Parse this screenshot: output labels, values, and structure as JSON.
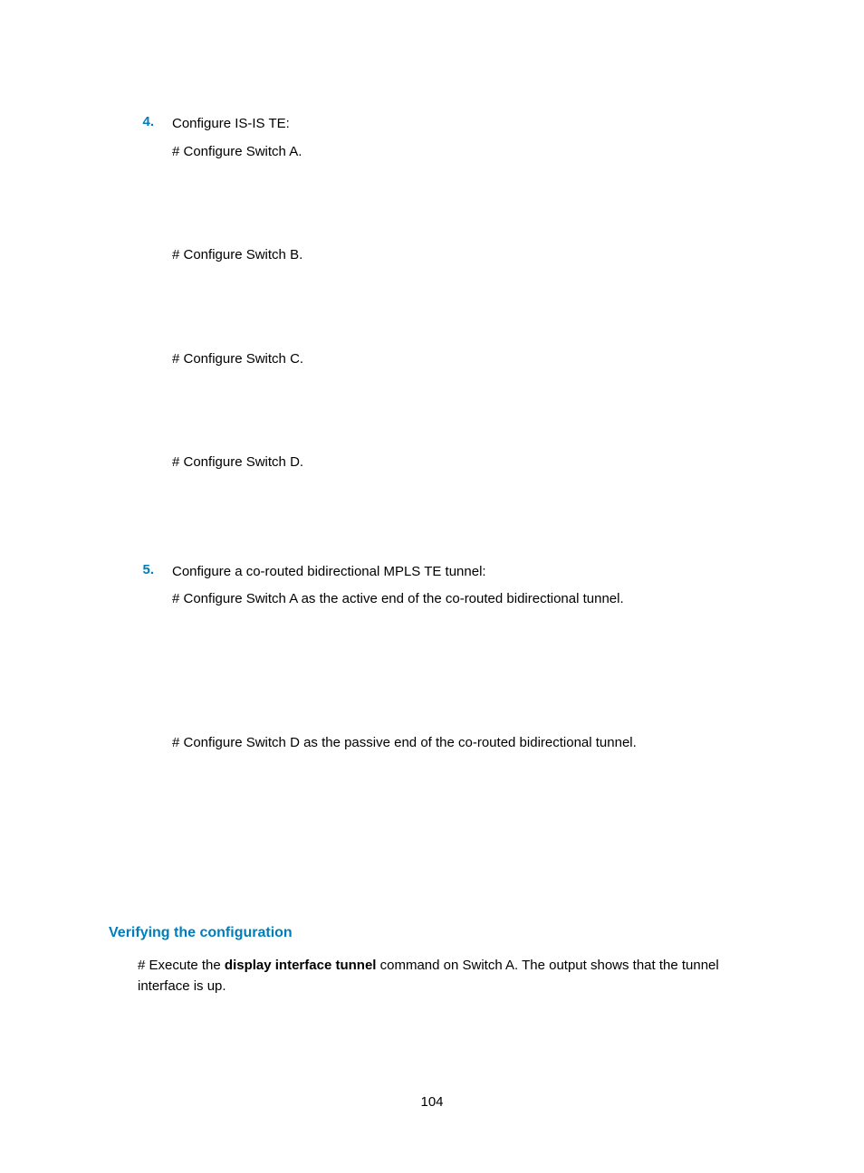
{
  "step4": {
    "num": "4.",
    "title": "Configure IS-IS TE:",
    "switchA": "# Configure Switch A.",
    "switchB": "# Configure Switch B.",
    "switchC": "# Configure Switch C.",
    "switchD": "# Configure Switch D."
  },
  "step5": {
    "num": "5.",
    "title": "Configure a co-routed bidirectional MPLS TE tunnel:",
    "switchA": "# Configure Switch A as the active end of the co-routed bidirectional tunnel.",
    "switchD": "# Configure Switch D as the passive end of the co-routed bidirectional tunnel."
  },
  "verify": {
    "heading": "Verifying the configuration",
    "text_pre": "# Execute the ",
    "text_bold": "display interface tunnel",
    "text_post": " command on Switch A. The output shows that the tunnel interface is up."
  },
  "pageNumber": "104"
}
